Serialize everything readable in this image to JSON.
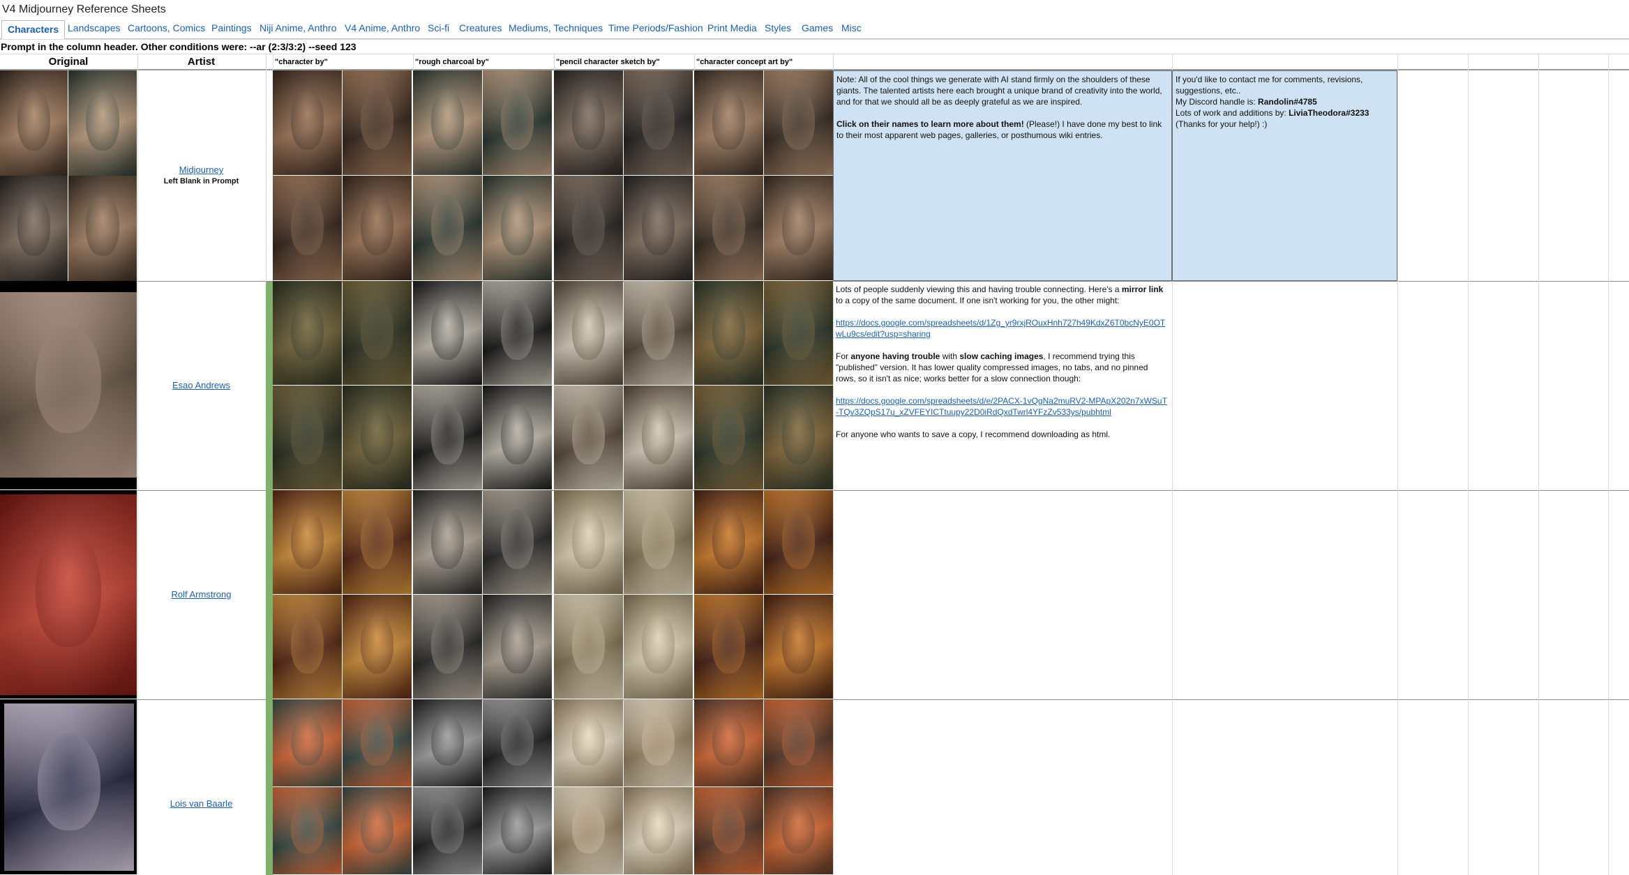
{
  "doc_title": "V4 Midjourney Reference Sheets",
  "tabs": [
    "Characters",
    "Landscapes",
    "Cartoons, Comics",
    "Paintings",
    "Niji Anime, Anthro",
    "V4 Anime, Anthro",
    "Sci-fi",
    "Creatures",
    "Mediums, Techniques",
    "Time Periods/Fashion",
    "Print Media",
    "Styles",
    "Games",
    "Misc"
  ],
  "info_row": "Prompt in the column header. Other conditions were: --ar (2:3/3:2) --seed 123",
  "headers": {
    "original": "Original",
    "artist": "Artist",
    "prompts": [
      "\"character by\"",
      "\"rough charcoal by\"",
      "\"pencil character sketch by\"",
      "\"character concept art by\""
    ]
  },
  "rows": [
    {
      "artist": "Midjourney",
      "artist_note": "Left Blank in Prompt"
    },
    {
      "artist": "Esao Andrews",
      "artist_note": ""
    },
    {
      "artist": "Rolf Armstrong",
      "artist_note": ""
    },
    {
      "artist": "Lois van Baarle",
      "artist_note": ""
    }
  ],
  "notes": {
    "note1_p1": "Note: All of the cool things we generate with AI stand firmly on the shoulders of these giants. The talented artists here each brought a unique brand of creativity into the world, and for that we should all be as deeply grateful as we are inspired.",
    "note1_p2_bold": "Click on their names to learn more about them!",
    "note1_p2_rest": " (Please!) I have done my best to link to their most apparent web pages, galleries, or posthumous wiki entries.",
    "contact_line1": "If you'd like to contact me for comments, revisions, suggestions, etc..",
    "contact_discord_label": "My Discord handle is: ",
    "contact_discord": "Randolin#4785",
    "contact_work_label": "Lots of work and additions by: ",
    "contact_work": "LiviaTheodora#3233",
    "contact_thanks": "(Thanks for your help!) :)",
    "mirror_p1_a": "Lots of people suddenly viewing this and having trouble connecting. Here's a ",
    "mirror_p1_bold": "mirror link",
    "mirror_p1_b": " to a copy of the same document. If one isn't working for you, the other might:",
    "mirror_link1": "https://docs.google.com/spreadsheets/d/1Zg_yr9rxjROuxHnh727h49KdxZ6T0bcNyE0OTwLu9cs/edit?usp=sharing",
    "mirror_p2_a": "For ",
    "mirror_p2_bold1": "anyone having trouble",
    "mirror_p2_b": " with ",
    "mirror_p2_bold2": "slow caching images",
    "mirror_p2_c": ", I recommend trying this \"published\" version. It has lower quality compressed images, no tabs, and no pinned rows, so it isn't as nice; works better for a slow connection though:",
    "mirror_link2": "https://docs.google.com/spreadsheets/d/e/2PACX-1vQgNa2muRV2-MPApX202n7xWSuT-TQv3ZQpS17u_xZVFEYICTtuupy22D0iRdQxdTwrl4YFzZv533ys/pubhtml",
    "mirror_p3": "For anyone who wants to save a copy, I recommend downloading as html."
  },
  "colors": {
    "link": "#1a5fb4",
    "note_bg": "#cfe2f3",
    "grid": "#d9d9d9",
    "green_strip": "#7fb06c"
  }
}
